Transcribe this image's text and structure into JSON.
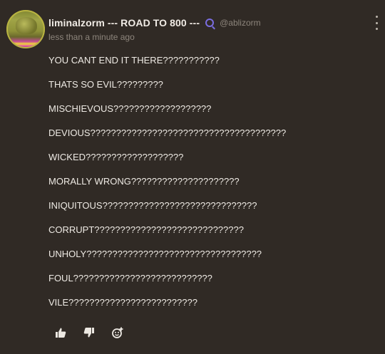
{
  "post": {
    "username": "liminalzorm --- ROAD TO 800 ---",
    "handle": "@ablizorm",
    "timestamp": "less than a minute ago",
    "lines": [
      "YOU CANT END IT THERE???????????",
      "THATS SO EVIL?????????",
      "MISCHIEVOUS???????????????????",
      "DEVIOUS??????????????????????????????????????",
      "WICKED???????????????????",
      "MORALLY WRONG?????????????????????",
      "INIQUITOUS??????????????????????????????",
      "CORRUPT?????????????????????????????",
      "UNHOLY??????????????????????????????????",
      "FOUL???????????????????????????",
      "VILE?????????????????????????"
    ]
  },
  "icons": {
    "verified": "badge-icon",
    "menu": "more-vertical-icon",
    "like": "thumbs-up-icon",
    "dislike": "thumbs-down-icon",
    "react": "add-reaction-icon"
  },
  "colors": {
    "background": "#302a25",
    "text": "#eeeae4",
    "muted": "#8d857c",
    "badge": "#7a6de0"
  }
}
